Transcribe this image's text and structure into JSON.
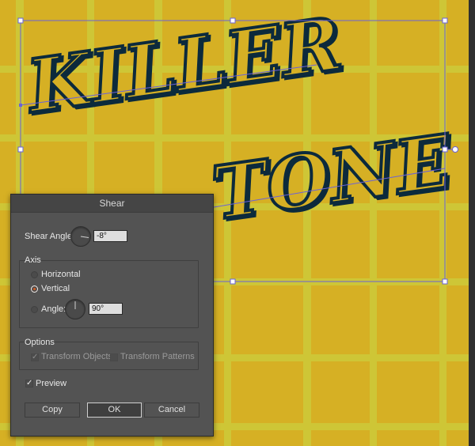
{
  "artwork": {
    "line1": "KILLER",
    "line2": "TONE"
  },
  "dialog": {
    "title": "Shear",
    "shear_angle_label": "Shear Angle:",
    "shear_angle_value": "-8°",
    "axis": {
      "legend": "Axis",
      "options": [
        "Horizontal",
        "Vertical",
        "Angle:"
      ],
      "selected": "Vertical",
      "angle_value": "90°"
    },
    "options": {
      "legend": "Options",
      "transform_objects_label": "Transform Objects",
      "transform_objects_checked": true,
      "transform_patterns_label": "Transform Patterns",
      "transform_patterns_checked": false
    },
    "preview_label": "Preview",
    "preview_checked": true,
    "buttons": {
      "copy": "Copy",
      "ok": "OK",
      "cancel": "Cancel"
    }
  },
  "colors": {
    "background": "#d6b024",
    "grid": "#cdcb3a",
    "ink": "#0c2a3c",
    "selection": "#6b62d8",
    "accent": "#d55c22"
  }
}
